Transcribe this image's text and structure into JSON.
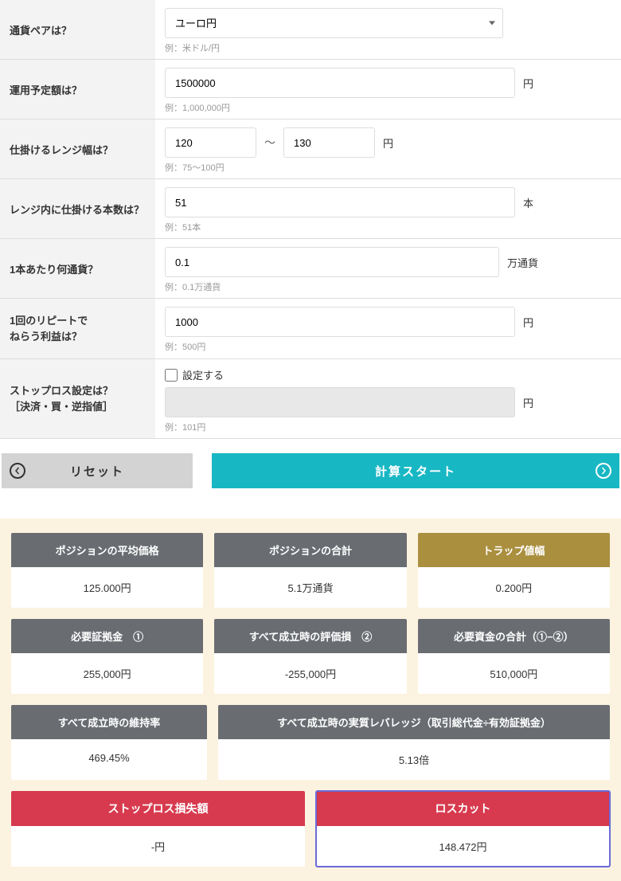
{
  "form": {
    "currency_pair": {
      "label": "通貨ペアは？",
      "value": "ユーロ円",
      "hint": "例：米ドル/円"
    },
    "budget": {
      "label": "運用予定額は？",
      "value": "1500000",
      "unit": "円",
      "hint": "例：1,000,000円"
    },
    "range": {
      "label": "仕掛けるレンジ幅は？",
      "from": "120",
      "to": "130",
      "unit": "円",
      "hint": "例：75～100円"
    },
    "count": {
      "label": "レンジ内に仕掛ける本数は？",
      "value": "51",
      "unit": "本",
      "hint": "例：51本"
    },
    "lot": {
      "label": "1本あたり何通貨？",
      "value": "0.1",
      "unit": "万通貨",
      "hint": "例：0.1万通貨"
    },
    "profit": {
      "label_line1": "1回のリピートで",
      "label_line2": "ねらう利益は？",
      "value": "1000",
      "unit": "円",
      "hint": "例：500円"
    },
    "stoploss": {
      "label_line1": "ストップロス設定は？",
      "label_line2": "［決済・買・逆指値］",
      "checkbox_label": "設定する",
      "value": "",
      "unit": "円",
      "hint": "例：101円"
    }
  },
  "buttons": {
    "reset": "リセット",
    "calc": "計算スタート"
  },
  "results": {
    "row1": [
      {
        "head": "ポジションの平均価格",
        "body": "125.000円"
      },
      {
        "head": "ポジションの合計",
        "body": "5.1万通貨"
      },
      {
        "head": "トラップ値幅",
        "body": "0.200円",
        "gold": true
      }
    ],
    "row2": [
      {
        "head": "必要証拠金　①",
        "body": "255,000円"
      },
      {
        "head": "すべて成立時の評価損　②",
        "body": "-255,000円"
      },
      {
        "head": "必要資金の合計（①−②）",
        "body": "510,000円"
      }
    ],
    "row3": [
      {
        "head": "すべて成立時の維持率",
        "body": "469.45%"
      },
      {
        "head": "すべて成立時の実質レバレッジ（取引総代金÷有効証拠金）",
        "body": "5.13倍"
      }
    ],
    "row4": [
      {
        "head": "ストップロス損失額",
        "body": "-円"
      },
      {
        "head": "ロスカット",
        "body": "148.472円"
      }
    ]
  }
}
